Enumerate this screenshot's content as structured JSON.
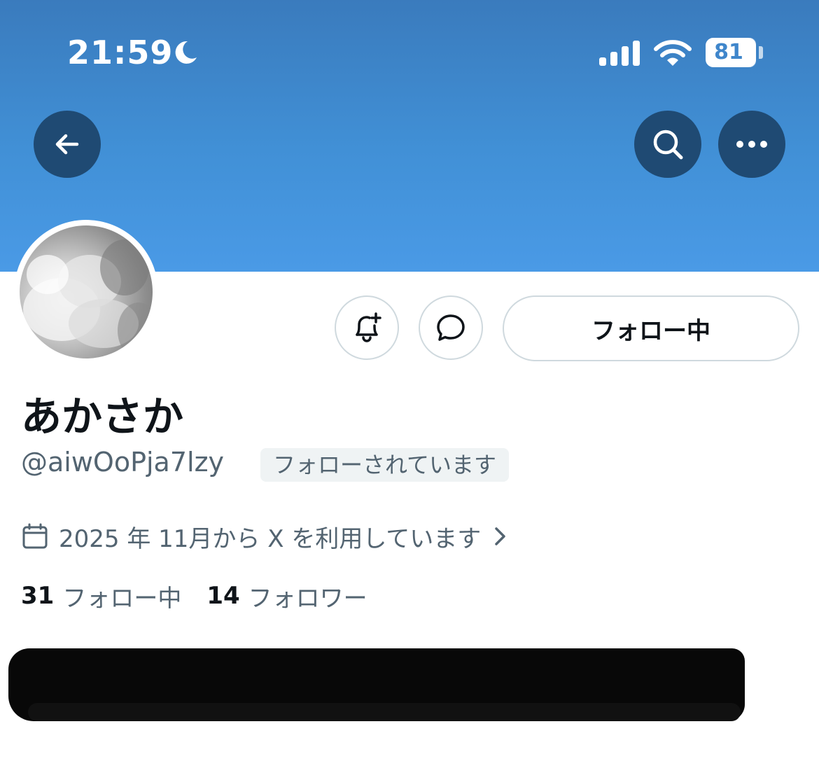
{
  "status_bar": {
    "time": "21:59",
    "battery": "81",
    "icons": [
      "moon-icon",
      "cellular-signal-icon",
      "wifi-icon",
      "battery-icon"
    ]
  },
  "header": {
    "back_icon": "back-arrow-icon",
    "search_icon": "search-icon",
    "more_icon": "more-horizontal-icon",
    "banner_color": "#4190d6"
  },
  "profile": {
    "display_name": "あかさか",
    "handle": "@aiwOoPja7lzy",
    "follows_you": "フォローされています",
    "joined": "2025 年 11月から X を利用しています",
    "following_count": "31",
    "following_label": "フォロー中",
    "followers_count": "14",
    "followers_label": "フォロワー"
  },
  "actions": {
    "notify_icon": "bell-plus-icon",
    "message_icon": "message-bubble-icon",
    "following_button": "フォロー中"
  },
  "colors": {
    "accent_dark": "#1f4a73",
    "secondary_text": "#536471",
    "primary_text": "#0f1419",
    "border": "#cfd9de"
  }
}
